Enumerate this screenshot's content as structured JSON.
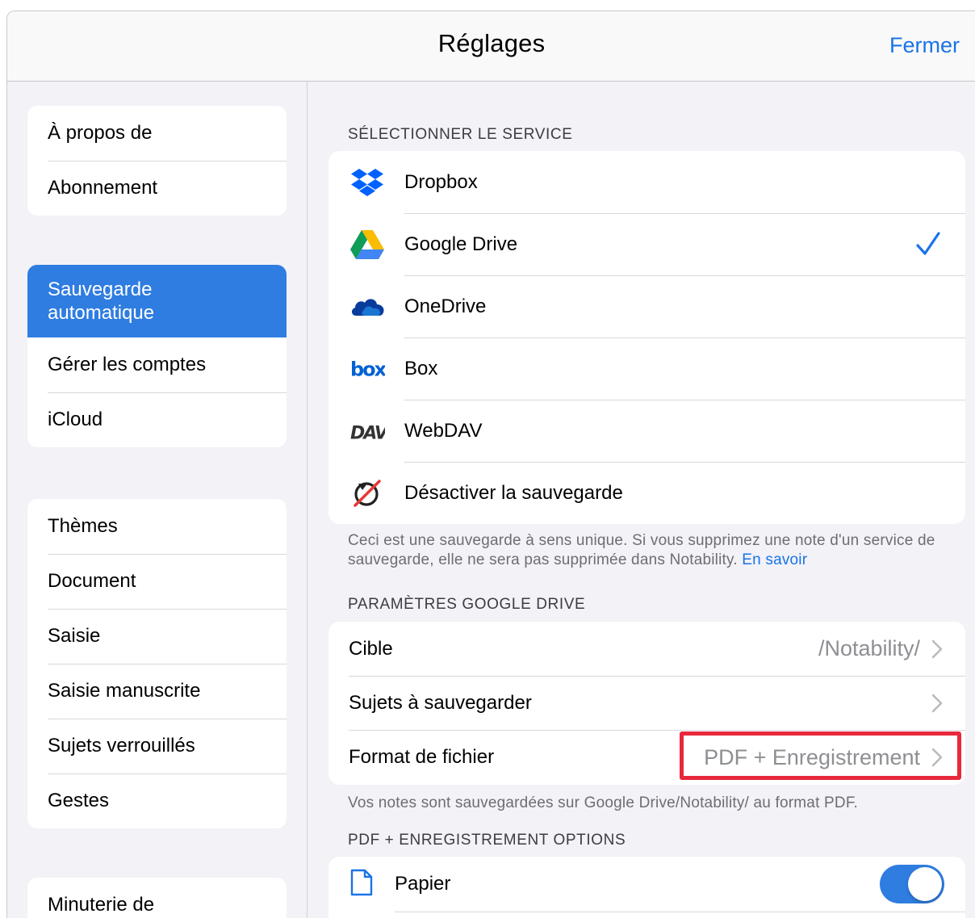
{
  "header": {
    "title": "Réglages",
    "close_label": "Fermer"
  },
  "sidebar": {
    "group1": [
      "À propos de",
      "Abonnement"
    ],
    "group2": [
      {
        "label_line1": "Sauvegarde",
        "label_line2": "automatique",
        "active": true
      },
      {
        "label": "Gérer les comptes"
      },
      {
        "label": "iCloud"
      }
    ],
    "group3": [
      "Thèmes",
      "Document",
      "Saisie",
      "Saisie manuscrite",
      "Sujets verrouillés",
      "Gestes"
    ],
    "group4": [
      "Minuterie de"
    ]
  },
  "service": {
    "header": "SÉLECTIONNER LE SERVICE",
    "items": [
      {
        "label": "Dropbox",
        "icon": "dropbox-icon"
      },
      {
        "label": "Google Drive",
        "icon": "google-drive-icon",
        "selected": true
      },
      {
        "label": "OneDrive",
        "icon": "onedrive-icon"
      },
      {
        "label": "Box",
        "icon": "box-icon"
      },
      {
        "label": "WebDAV",
        "icon": "webdav-icon"
      },
      {
        "label": "Désactiver la sauvegarde",
        "icon": "disable-backup-icon"
      }
    ],
    "footer_text": "Ceci est une sauvegarde à sens unique. Si vous supprimez une note d'un service de sauvegarde, elle ne sera pas supprimée dans Notability.",
    "footer_link": "En savoir"
  },
  "gdrive": {
    "header": "PARAMÈTRES GOOGLE DRIVE",
    "target_label": "Cible",
    "target_value": "/Notability/",
    "subjects_label": "Sujets à sauvegarder",
    "format_label": "Format de fichier",
    "format_value": "PDF + Enregistrement",
    "footer": "Vos notes sont sauvegardées sur Google Drive/Notability/ au format PDF."
  },
  "pdf_options": {
    "header": "PDF + ENREGISTREMENT OPTIONS",
    "paper_label": "Papier",
    "paper_enabled": true
  },
  "colors": {
    "accent": "#1a73e8",
    "active_row": "#2f7de1",
    "highlight": "#e8283c"
  }
}
